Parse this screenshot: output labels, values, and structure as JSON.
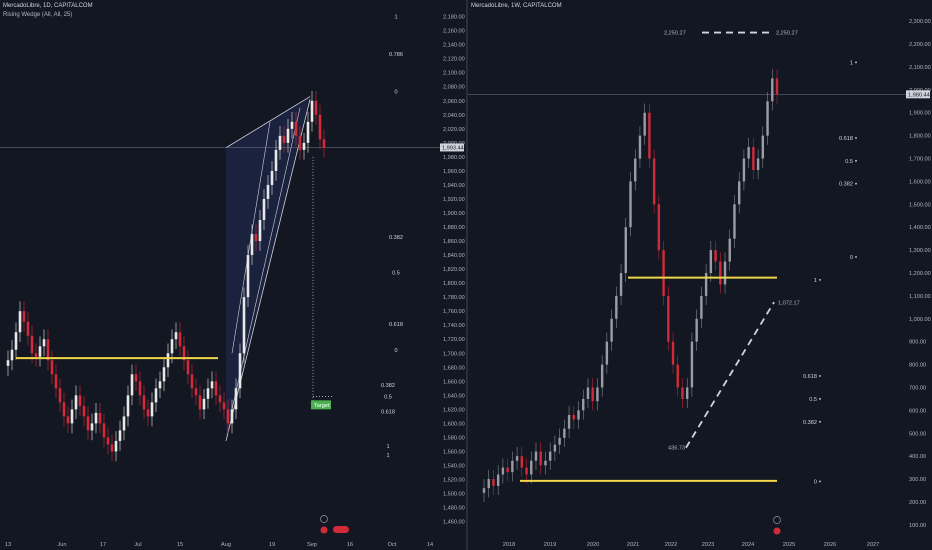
{
  "left_chart": {
    "title": "MercadoLibre, 1D, CAPITALCOM",
    "indicator": "Rising Wedge (All, All, 25)",
    "price_label": "1,993.44",
    "target_label": "Target",
    "colors": {
      "up": "#e8e8e8",
      "down": "#d12b3a",
      "support": "#f0d64a",
      "wedge": "#1d2341",
      "price_tag": "#d1d4dc",
      "target": "#4caf50"
    }
  },
  "right_chart": {
    "title": "MercadoLibre, 1W, CAPITALCOM",
    "price_label": "1,980.44",
    "projection_label_top": "2,250.27",
    "projection_label_top_right": "2,250.27",
    "projection_label_mid": "1,072.17",
    "projection_label_low": "436.73"
  },
  "chart_data": [
    {
      "type": "candlestick",
      "title": "MercadoLibre, 1D, CAPITALCOM",
      "y_ticks": [
        "2,180.00",
        "2,160.00",
        "2,140.00",
        "2,120.00",
        "2,100.00",
        "2,080.00",
        "2,060.00",
        "2,040.00",
        "2,020.00",
        "2,000.00",
        "1,980.00",
        "1,960.00",
        "1,940.00",
        "1,920.00",
        "1,900.00",
        "1,880.00",
        "1,860.00",
        "1,840.00",
        "1,820.00",
        "1,800.00",
        "1,780.00",
        "1,760.00",
        "1,740.00",
        "1,720.00",
        "1,700.00",
        "1,680.00",
        "1,660.00",
        "1,640.00",
        "1,620.00",
        "1,600.00",
        "1,580.00",
        "1,560.00",
        "1,540.00",
        "1,520.00",
        "1,500.00",
        "1,480.00",
        "1,460.00"
      ],
      "y_range": [
        1448,
        2188
      ],
      "x_ticks": [
        "13",
        "Jun",
        "17",
        "Jul",
        "15",
        "Aug",
        "19",
        "Sep",
        "16",
        "Oct",
        "14"
      ],
      "current_price": 1993.44,
      "support_level": 1693,
      "wedge_upper": [
        {
          "date": "Aug 1",
          "value": 1993
        },
        {
          "date": "Sep 5",
          "value": 2066
        }
      ],
      "wedge_lower": [
        {
          "date": "Aug 1",
          "value": 1575
        },
        {
          "date": "Sep 5",
          "value": 2062
        }
      ],
      "target_level": 1630,
      "fib_labels_upper": [
        "1",
        "0.786",
        "0",
        "0.382",
        "0.5",
        "0.618",
        "0"
      ],
      "fib_values_upper": [
        2180,
        2127,
        2073,
        1866,
        1815,
        1742,
        1705
      ],
      "fib_labels_lower": [
        "0.382",
        "0.5",
        "0.618",
        "1",
        "1"
      ],
      "fib_values_lower": [
        1655,
        1638,
        1617,
        1568,
        1555
      ],
      "closes_approx": [
        1690,
        1705,
        1730,
        1760,
        1745,
        1725,
        1700,
        1695,
        1710,
        1720,
        1690,
        1670,
        1650,
        1630,
        1610,
        1600,
        1620,
        1640,
        1625,
        1610,
        1590,
        1600,
        1615,
        1600,
        1580,
        1570,
        1560,
        1575,
        1590,
        1610,
        1640,
        1670,
        1660,
        1640,
        1620,
        1610,
        1630,
        1650,
        1660,
        1680,
        1700,
        1720,
        1730,
        1710,
        1690,
        1670,
        1650,
        1640,
        1620,
        1635,
        1650,
        1660,
        1640,
        1630,
        1620,
        1600,
        1620,
        1650,
        1700,
        1780,
        1840,
        1870,
        1860,
        1890,
        1920,
        1940,
        1960,
        1990,
        2010,
        2000,
        2020,
        2030,
        2010,
        1990,
        2000,
        2030,
        2060,
        2040,
        2005,
        1993
      ]
    },
    {
      "type": "candlestick",
      "title": "MercadoLibre, 1W, CAPITALCOM",
      "y_ticks": [
        "2,300.00",
        "2,200.00",
        "2,100.00",
        "2,000.00",
        "1,900.00",
        "1,800.00",
        "1,700.00",
        "1,600.00",
        "1,500.00",
        "1,400.00",
        "1,300.00",
        "1,200.00",
        "1,100.00",
        "1,000.00",
        "900.00",
        "800.00",
        "700.00",
        "600.00",
        "500.00",
        "400.00",
        "300.00",
        "200.00",
        "100.00"
      ],
      "y_range": [
        60,
        2340
      ],
      "x_ticks": [
        "2018",
        "2019",
        "2020",
        "2021",
        "2022",
        "2023",
        "2024",
        "2025",
        "2026",
        "2027"
      ],
      "current_price": 1980.44,
      "support_levels": [
        1180,
        292
      ],
      "projection_line_top": 2250.27,
      "projection_line_rising": [
        {
          "date": "2022-08",
          "value": 436.73
        },
        {
          "date": "2024-09",
          "value": 1072.17
        }
      ],
      "fib_labels_upper": [
        "1",
        "0.618",
        "0.5",
        "0.382",
        "0"
      ],
      "fib_values_upper": [
        2120,
        1790,
        1690,
        1590,
        1270
      ],
      "fib_labels_lower": [
        "1",
        "0.618",
        "0.5",
        "0.382",
        "0"
      ],
      "fib_values_lower": [
        1170,
        750,
        650,
        550,
        290
      ],
      "closes_approx": [
        260,
        300,
        270,
        320,
        350,
        330,
        380,
        400,
        350,
        320,
        380,
        420,
        360,
        380,
        420,
        450,
        480,
        520,
        580,
        560,
        600,
        650,
        700,
        640,
        700,
        800,
        900,
        1000,
        1100,
        1200,
        1400,
        1600,
        1700,
        1800,
        1900,
        1700,
        1500,
        1300,
        1100,
        900,
        800,
        700,
        650,
        700,
        900,
        1000,
        1100,
        1200,
        1300,
        1250,
        1150,
        1250,
        1350,
        1500,
        1600,
        1700,
        1750,
        1650,
        1700,
        1800,
        1950,
        2050,
        1980
      ]
    }
  ]
}
